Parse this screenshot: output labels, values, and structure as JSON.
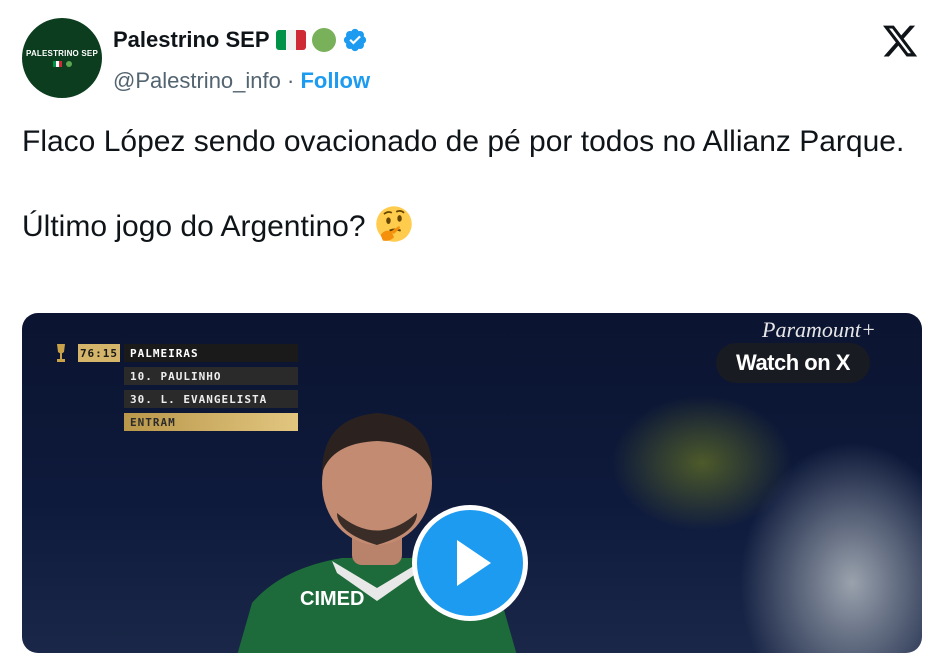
{
  "author": {
    "display_name": "Palestrino SEP",
    "handle": "@Palestrino_info",
    "separator": "·",
    "follow_label": "Follow",
    "avatar_text": "PALESTRINO SEP",
    "verified": true
  },
  "tweet": {
    "line1": "Flaco López sendo ovacionado de pé por todos no Allianz Parque.",
    "line2": "Último jogo do Argentino?",
    "emoji": "thinking-face"
  },
  "video": {
    "watch_label": "Watch on X",
    "watermark": "Paramount+",
    "scoreboard": {
      "time": "76:15",
      "team": "PALMEIRAS",
      "players": [
        "10. PAULINHO",
        "30. L. EVANGELISTA"
      ],
      "status": "ENTRAM"
    },
    "jersey_sponsor": "CIMED"
  },
  "colors": {
    "accent": "#1d9bf0",
    "text": "#0f1419",
    "muted": "#536471",
    "italy_green": "#009246",
    "italy_white": "#f1f2f1",
    "italy_red": "#ce2b37"
  }
}
